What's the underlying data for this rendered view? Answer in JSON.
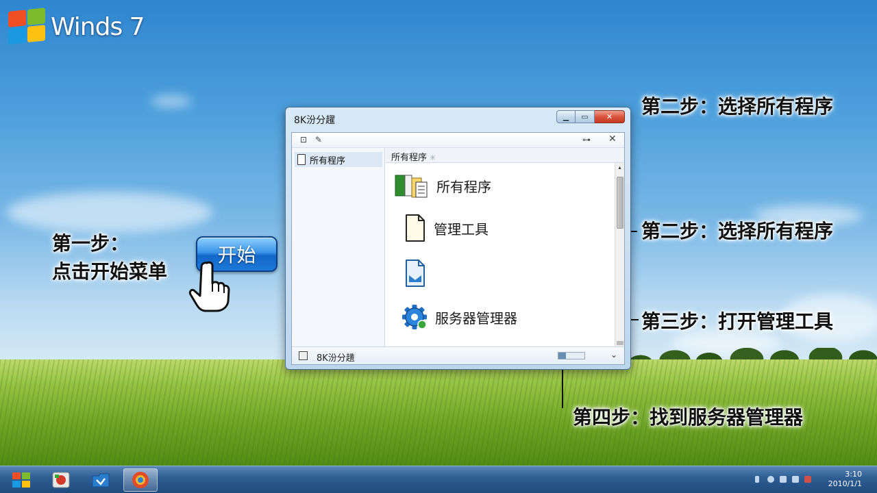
{
  "branding": {
    "logo_text": "Winds 7"
  },
  "captions": {
    "step1_line1": "第一步：",
    "step1_line2": "点击开始菜单",
    "step2a": "第二步：选择所有程序",
    "step2b": "第二步：选择所有程序",
    "step3": "第三步：打开管理工具",
    "step4": "第四步：找到服务器管理器"
  },
  "start_button": {
    "label": "开始"
  },
  "window": {
    "title": "8K汾分趯",
    "sidebar": {
      "selected_item": "所有程序"
    },
    "content_header": "所有程序",
    "items": [
      {
        "label": "所有程序",
        "icon": "programs-icon"
      },
      {
        "label": "管理工具",
        "icon": "document-icon"
      },
      {
        "label": "",
        "icon": "blue-document-icon"
      },
      {
        "label": "服务器管理器",
        "icon": "gear-icon"
      }
    ],
    "status_text": "8K汾分趪"
  },
  "taskbar": {
    "clock_line1": "3:10",
    "clock_line2": "2010/1/1"
  },
  "colors": {
    "accent": "#1c7ad8",
    "close_button": "#c53a22",
    "caption_text": "#111111"
  }
}
